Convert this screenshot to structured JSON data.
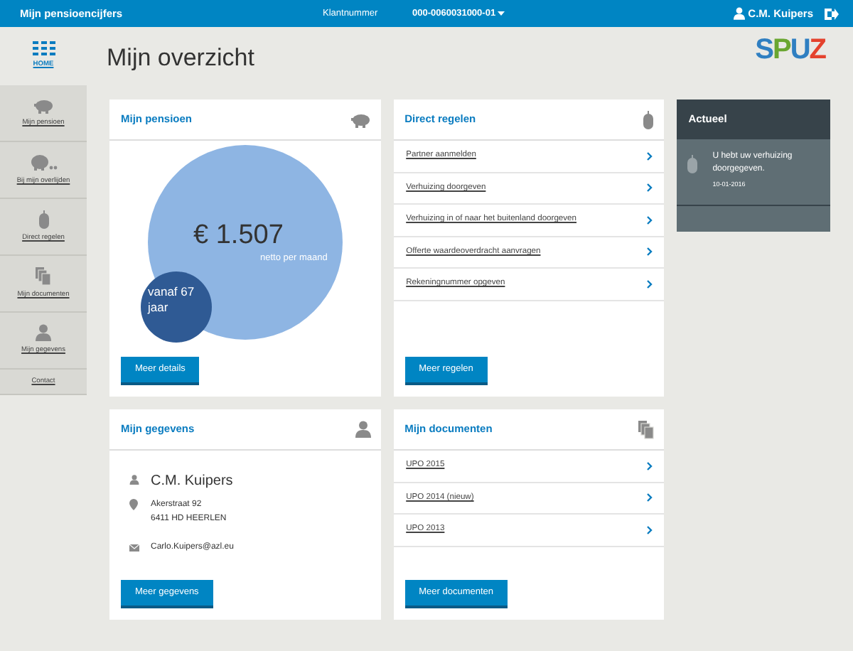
{
  "topbar": {
    "title": "Mijn pensioencijfers",
    "account_label": "Klantnummer",
    "account_number": "000-0060031000-01",
    "user": "C.M. Kuipers"
  },
  "sidebar": {
    "items": [
      {
        "kind": "home",
        "label": "HOME",
        "selected": true
      },
      {
        "kind": "piggy",
        "label": "Mijn pensioen",
        "selected": false
      },
      {
        "kind": "piggy-dots",
        "label": "Bij mijn overlijden",
        "selected": false
      },
      {
        "kind": "mouse",
        "label": "Direct regelen",
        "selected": false
      },
      {
        "kind": "documents",
        "label": "Mijn documenten",
        "selected": false
      },
      {
        "kind": "person",
        "label": "Mijn gegevens",
        "selected": false
      },
      {
        "kind": "text",
        "label": "Contact",
        "selected": false
      }
    ]
  },
  "page_title": "Mijn overzicht",
  "logo": "SPUZ",
  "pension": {
    "title": "Mijn pensioen",
    "amount": "€ 1.507",
    "amount_caption": "netto per maand",
    "from_age": "vanaf 67 jaar",
    "button": "Meer details"
  },
  "direct": {
    "title": "Direct regelen",
    "items": [
      "Partner aanmelden",
      "Verhuizing doorgeven",
      "Verhuizing in of naar het buitenland doorgeven",
      "Offerte waardeoverdracht aanvragen",
      "Rekeningnummer opgeven"
    ],
    "button": "Meer regelen"
  },
  "news": {
    "title": "Actueel",
    "items": [
      {
        "text": "U hebt uw verhuizing doorgegeven.",
        "date": "10-01-2016"
      }
    ]
  },
  "details": {
    "title": "Mijn gegevens",
    "name": "C.M. Kuipers",
    "address": [
      "Akerstraat 92",
      "6411 HD HEERLEN"
    ],
    "email": "Carlo.Kuipers@azl.eu",
    "button": "Meer gegevens"
  },
  "documents": {
    "title": "Mijn documenten",
    "items": [
      "UPO 2015",
      "UPO 2014 (nieuw)",
      "UPO 2013"
    ],
    "button": "Meer documenten"
  }
}
